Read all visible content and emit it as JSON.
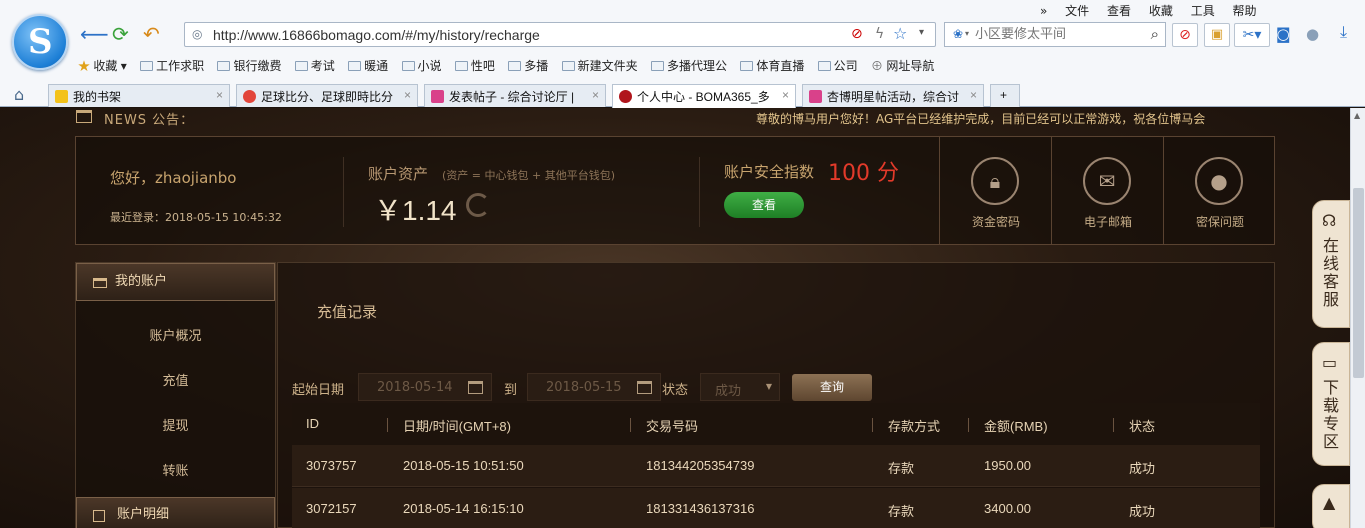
{
  "browser": {
    "url": "http://www.16866bomago.com/#/my/history/recharge",
    "search_placeholder": "小区要修太平间",
    "menu": [
      "文件",
      "查看",
      "收藏",
      "工具",
      "帮助"
    ],
    "bookmarks": [
      "收藏",
      "工作求职",
      "银行缴费",
      "考试",
      "暖通",
      "小说",
      "性吧",
      "多播",
      "新建文件夹",
      "多播代理公",
      "体育直播",
      "公司",
      "网址导航"
    ],
    "tabs": [
      {
        "label": "我的书架"
      },
      {
        "label": "足球比分、足球即時比分"
      },
      {
        "label": "发表帖子 - 综合讨论厅 |"
      },
      {
        "label": "个人中心 - BOMA365_多"
      },
      {
        "label": "杏博明星帖活动，综合讨"
      }
    ]
  },
  "news": {
    "label": "NEWS 公告：",
    "ticker": "尊敬的博马用户您好！AG平台已经维护完成，目前已经可以正常游戏，祝各位博马会"
  },
  "account": {
    "greeting": "您好，zhaojianbo",
    "last_login": "最近登录：2018-05-15 10:45:32",
    "asset_label": "账户资产",
    "asset_note": "(资产 = 中心钱包 + 其他平台钱包)",
    "asset_value": "￥1.14",
    "security_label": "账户安全指数",
    "security_value": "100 分",
    "view_button": "查看",
    "quick": [
      {
        "label": "资金密码",
        "icon": "lock-icon"
      },
      {
        "label": "电子邮箱",
        "icon": "mail-icon"
      },
      {
        "label": "密保问题",
        "icon": "bulb-icon"
      }
    ]
  },
  "sidebar": {
    "section1": "我的账户",
    "items": [
      "账户概况",
      "充值",
      "提现",
      "转账"
    ],
    "section2": "账户明细"
  },
  "main": {
    "title": "充值记录",
    "filter": {
      "start_label": "起始日期",
      "start_value": "2018-05-14",
      "to_label": "到",
      "end_value": "2018-05-15",
      "status_label": "状态",
      "status_value": "成功",
      "query_button": "查询"
    },
    "table": {
      "headers": [
        "ID",
        "日期/时间(GMT+8)",
        "交易号码",
        "存款方式",
        "金额(RMB)",
        "状态"
      ],
      "rows": [
        [
          "3073757",
          "2018-05-15 10:51:50",
          "181344205354739",
          "存款",
          "1950.00",
          "成功"
        ],
        [
          "3072157",
          "2018-05-14 16:15:10",
          "181331436137316",
          "存款",
          "3400.00",
          "成功"
        ]
      ]
    }
  },
  "float": {
    "service": "在线客服",
    "download": "下载专区"
  }
}
